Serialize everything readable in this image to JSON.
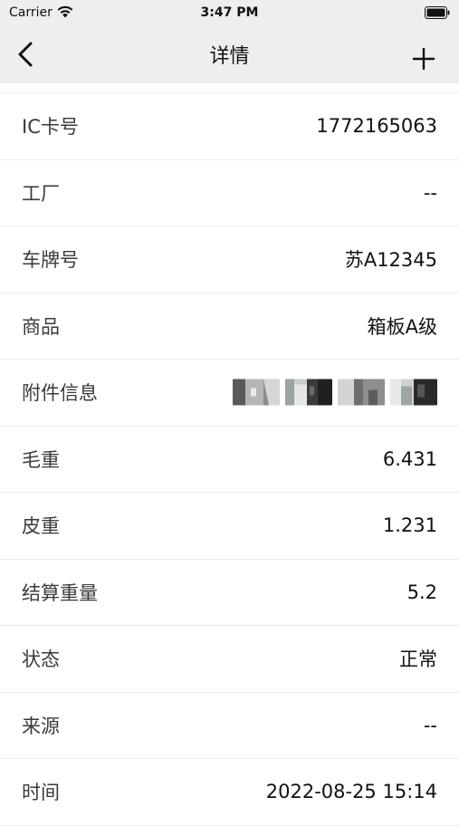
{
  "status_bar": {
    "carrier": "Carrier",
    "time": "3:47 PM"
  },
  "nav": {
    "title": "详情",
    "back_icon": "chevron-left-icon",
    "add_icon": "plus-icon"
  },
  "rows": [
    {
      "label": "IC卡号",
      "value": "1772165063"
    },
    {
      "label": "工厂",
      "value": "--"
    },
    {
      "label": "车牌号",
      "value": "苏A12345"
    },
    {
      "label": "商品",
      "value": "箱板A级"
    },
    {
      "label": "附件信息",
      "value": null
    },
    {
      "label": "毛重",
      "value": "6.431"
    },
    {
      "label": "皮重",
      "value": "1.231"
    },
    {
      "label": "结算重量",
      "value": "5.2"
    },
    {
      "label": "状态",
      "value": "正常"
    },
    {
      "label": "来源",
      "value": "--"
    },
    {
      "label": "时间",
      "value": "2022-08-25 15:14"
    }
  ],
  "attachments": [
    {
      "type": "photo-thumbnail"
    },
    {
      "type": "photo-thumbnail"
    },
    {
      "type": "photo-thumbnail"
    },
    {
      "type": "photo-thumbnail"
    }
  ]
}
